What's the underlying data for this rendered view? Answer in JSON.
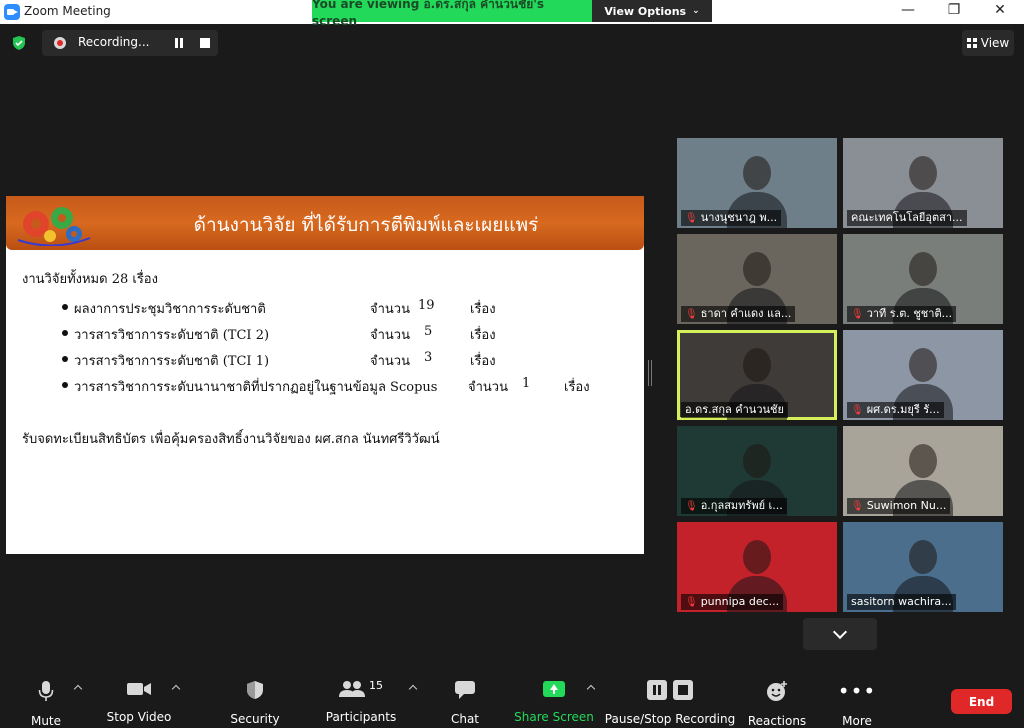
{
  "window": {
    "title": "Zoom Meeting",
    "viewing_banner": "You are viewing อ.ดร.สกุล  คำนวนชัย's screen",
    "view_options_label": "View Options",
    "minimize": "—",
    "restore": "❐",
    "close": "✕"
  },
  "recording": {
    "label": "Recording..."
  },
  "view_button": {
    "label": "View"
  },
  "slide": {
    "title": "ด้านงานวิจัย ที่ได้รับการตีพิมพ์และเผยแพร่",
    "total": "งานวิจัยทั้งหมด 28 เรื่อง",
    "items": [
      {
        "label": "ผลงาการประชุมวิชาการระดับชาติ",
        "count_word": "จำนวน",
        "count": "19",
        "unit": "เรื่อง"
      },
      {
        "label": "วารสารวิชาการระดับชาติ (TCI 2)",
        "count_word": "จำนวน",
        "count": "5",
        "unit": "เรื่อง"
      },
      {
        "label": "วารสารวิชาการระดับชาติ (TCI 1)",
        "count_word": "จำนวน",
        "count": "3",
        "unit": "เรื่อง"
      },
      {
        "label": "วารสารวิชาการระดับนานาชาติที่ปรากฏอยู่ในฐานข้อมูล Scopus",
        "count_word": "จำนวน",
        "count": "1",
        "unit": "เรื่อง"
      }
    ],
    "patent": "รับจดทะเบียนสิทธิบัตร เพื่อคุ้มครองสิทธิ์งานวิจัยของ ผศ.สกล  นันทศรีวิวัฒน์"
  },
  "participants": [
    {
      "name": "นางนุชนาฎ  พ...",
      "muted": true,
      "color": "#6e7f8a"
    },
    {
      "name": "คณะเทคโนโลยีอุตสา...",
      "muted": false,
      "color": "#8a8f96"
    },
    {
      "name": "ธาดา คำแดง แล...",
      "muted": true,
      "color": "#6a665e"
    },
    {
      "name": "วาที ร.ต. ชูชาติ...",
      "muted": true,
      "color": "#7a7e7a"
    },
    {
      "name": "อ.ดร.สกุล  คำนวนชัย",
      "muted": false,
      "color": "#3f3b38",
      "active": true
    },
    {
      "name": "ผศ.ดร.มยุรี  รั...",
      "muted": true,
      "color": "#8d96a4"
    },
    {
      "name": "อ.กุลสมทรัพย์ เ...",
      "muted": true,
      "color": "#1f3a34"
    },
    {
      "name": "Suwimon Nu...",
      "muted": true,
      "color": "#a8a49a"
    },
    {
      "name": "punnipa dec...",
      "muted": true,
      "color": "#c4222a"
    },
    {
      "name": "sasitorn wachira...",
      "muted": false,
      "color": "#4a6e8c"
    }
  ],
  "toolbar": {
    "mute": "Mute",
    "stop_video": "Stop Video",
    "security": "Security",
    "participants": "Participants",
    "participants_count": "15",
    "chat": "Chat",
    "share_screen": "Share Screen",
    "pause_stop_recording": "Pause/Stop Recording",
    "reactions": "Reactions",
    "more": "More",
    "end": "End"
  },
  "colors": {
    "share_green": "#23d959",
    "end_red": "#e02828",
    "active_speaker": "#d5f05a",
    "slide_header": "#c65a1a"
  }
}
